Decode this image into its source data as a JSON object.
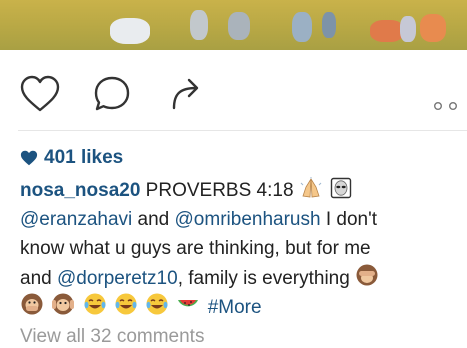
{
  "post": {
    "likes_text": "401 likes",
    "caption": {
      "username": "nosa_nosa20",
      "line1_text": " PROVERBS 4:18",
      "mention1": "@eranzahavi",
      "and1": " and ",
      "mention2": "@omribenharush",
      "line2_tail": " I don't",
      "line3_text": "know what u guys are thinking, but for me",
      "and2": "and ",
      "mention3": "@dorperetz10",
      "line4_tail": ", family is everything ",
      "hashtag": "#More"
    },
    "view_comments": "View all 32 comments"
  },
  "icons": {
    "like": "heart-outline-icon",
    "comment": "speech-bubble-icon",
    "share": "share-arrow-icon",
    "more": "more-dots-icon",
    "likes_heart": "heart-filled-icon"
  },
  "colors": {
    "link": "#1c5380",
    "muted": "#9a9a9a",
    "icon_stroke": "#333333"
  }
}
